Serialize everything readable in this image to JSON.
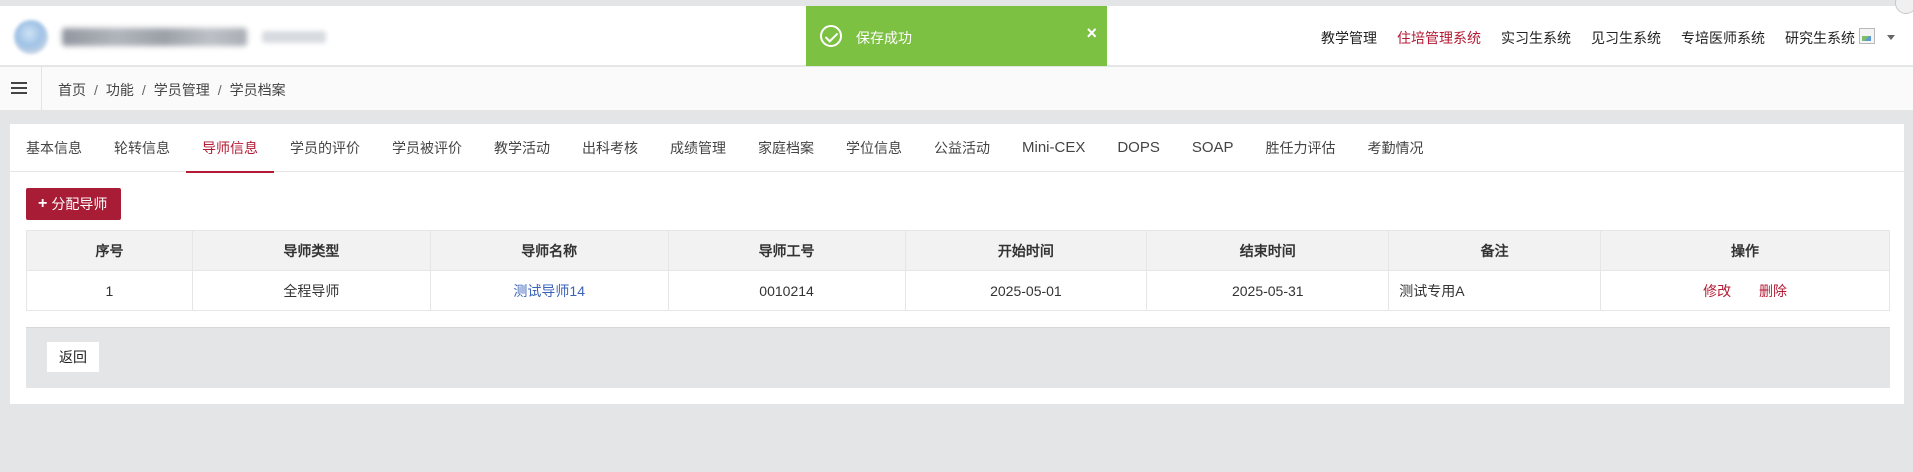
{
  "colors": {
    "accent": "#b31b34",
    "button_primary": "#a81c36",
    "toast_success": "#7cc142",
    "link_blue": "#3a64b8",
    "page_bg": "#e4e5e7"
  },
  "header": {
    "nav": [
      {
        "label": "教学管理",
        "active": false
      },
      {
        "label": "住培管理系统",
        "active": true
      },
      {
        "label": "实习生系统",
        "active": false
      },
      {
        "label": "见习生系统",
        "active": false
      },
      {
        "label": "专培医师系统",
        "active": false
      },
      {
        "label": "研究生系统",
        "active": false
      }
    ]
  },
  "toast": {
    "message": "保存成功",
    "close_symbol": "×",
    "icon": "check-circle-icon"
  },
  "breadcrumb": {
    "items": [
      "首页",
      "功能",
      "学员管理",
      "学员档案"
    ],
    "separator": "/"
  },
  "tabs": [
    {
      "label": "基本信息",
      "active": false
    },
    {
      "label": "轮转信息",
      "active": false
    },
    {
      "label": "导师信息",
      "active": true
    },
    {
      "label": "学员的评价",
      "active": false
    },
    {
      "label": "学员被评价",
      "active": false
    },
    {
      "label": "教学活动",
      "active": false
    },
    {
      "label": "出科考核",
      "active": false
    },
    {
      "label": "成绩管理",
      "active": false
    },
    {
      "label": "家庭档案",
      "active": false
    },
    {
      "label": "学位信息",
      "active": false
    },
    {
      "label": "公益活动",
      "active": false
    },
    {
      "label": "Mini-CEX",
      "active": false
    },
    {
      "label": "DOPS",
      "active": false
    },
    {
      "label": "SOAP",
      "active": false
    },
    {
      "label": "胜任力评估",
      "active": false
    },
    {
      "label": "考勤情况",
      "active": false
    }
  ],
  "toolbar": {
    "assign_label": "分配导师",
    "assign_icon": "plus-icon"
  },
  "table": {
    "columns": [
      "序号",
      "导师类型",
      "导师名称",
      "导师工号",
      "开始时间",
      "结束时间",
      "备注",
      "操作"
    ],
    "rows": [
      {
        "index": "1",
        "mentor_type": "全程导师",
        "mentor_name": "测试导师14",
        "mentor_id": "0010214",
        "start_date": "2025-05-01",
        "end_date": "2025-05-31",
        "remark": "测试专用A",
        "actions": {
          "edit": "修改",
          "delete": "删除"
        }
      }
    ]
  },
  "footer": {
    "back_label": "返回"
  }
}
